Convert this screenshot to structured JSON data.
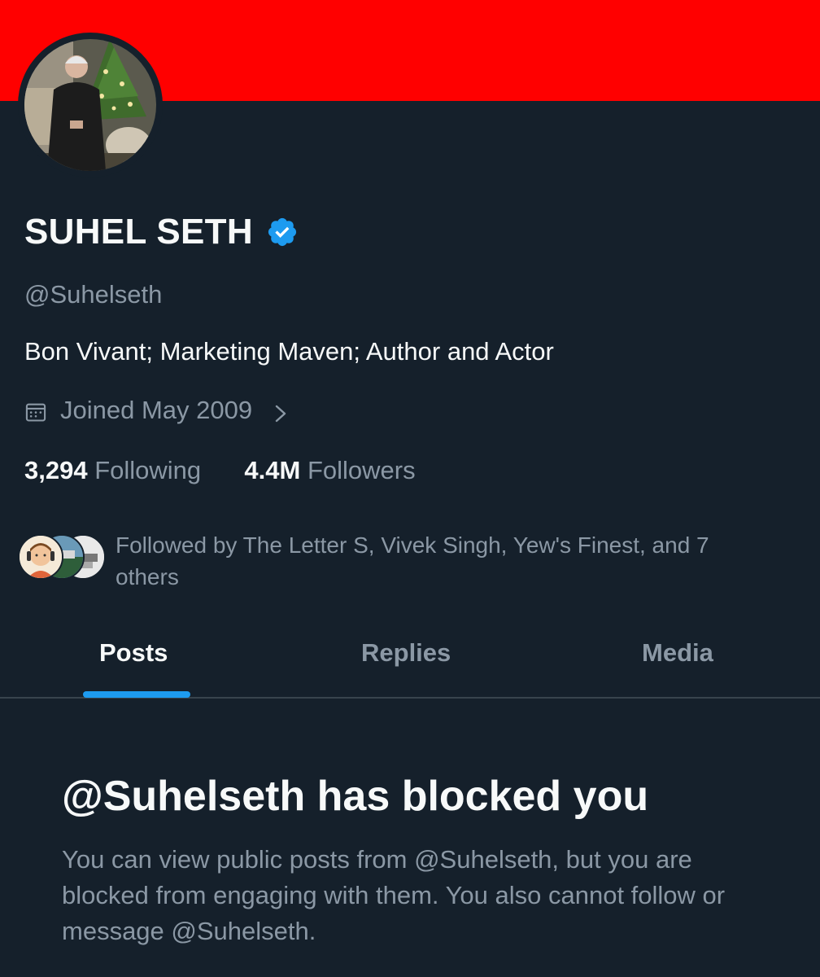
{
  "banner": {
    "color": "#ff0000"
  },
  "profile": {
    "display_name": "SUHEL SETH",
    "verified_icon": "verified-badge-icon",
    "handle": "@Suhelseth",
    "bio": "Bon Vivant; Marketing Maven; Author and Actor",
    "joined_text": "Joined May 2009",
    "joined_icon": "calendar-icon",
    "stats": {
      "following_count": "3,294",
      "following_label": "Following",
      "followers_count": "4.4M",
      "followers_label": "Followers"
    },
    "followed_by_text": "Followed by The Letter S, Vivek Singh, Yew's Finest, and 7 others"
  },
  "tabs": [
    {
      "label": "Posts",
      "active": true
    },
    {
      "label": "Replies",
      "active": false
    },
    {
      "label": "Media",
      "active": false
    }
  ],
  "blocked": {
    "title": "@Suhelseth has blocked you",
    "description": "You can view public posts from @Suhelseth, but you are blocked from engaging with them. You also cannot follow or message @Suhelseth."
  },
  "colors": {
    "background": "#15202b",
    "text_primary": "#f7f9f9",
    "text_secondary": "#8b98a5",
    "accent": "#1d9bf0",
    "divider": "#38444d"
  }
}
